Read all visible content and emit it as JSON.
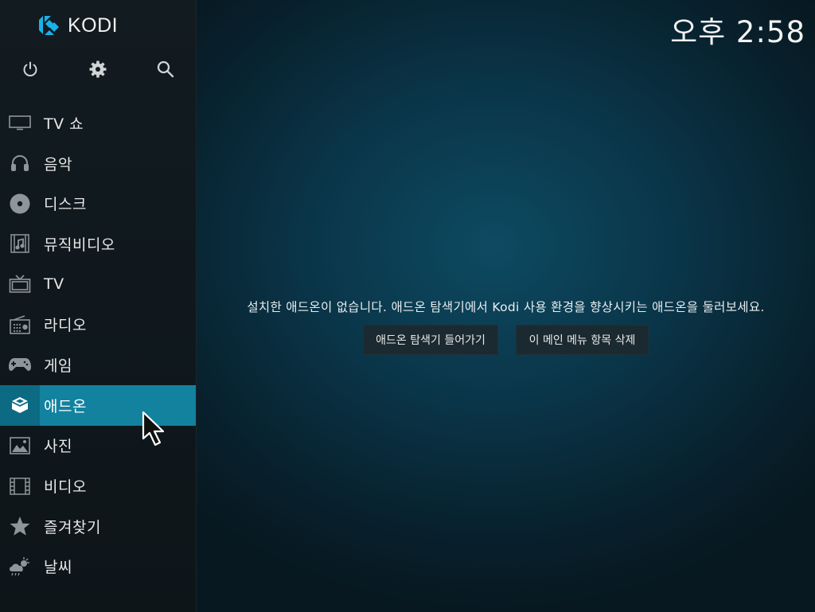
{
  "app": {
    "logo_text": "KODI"
  },
  "clock": "오후 2:58",
  "top_icons": [
    "power-icon",
    "settings-icon",
    "search-icon"
  ],
  "menu": [
    {
      "label": "TV 쇼",
      "icon": "tv-icon",
      "active": false
    },
    {
      "label": "음악",
      "icon": "headphones-icon",
      "active": false
    },
    {
      "label": "디스크",
      "icon": "disc-icon",
      "active": false
    },
    {
      "label": "뮤직비디오",
      "icon": "music-video-icon",
      "active": false
    },
    {
      "label": "TV",
      "icon": "live-tv-icon",
      "active": false
    },
    {
      "label": "라디오",
      "icon": "radio-icon",
      "active": false
    },
    {
      "label": "게임",
      "icon": "gamepad-icon",
      "active": false
    },
    {
      "label": "애드온",
      "icon": "addon-box-icon",
      "active": true
    },
    {
      "label": "사진",
      "icon": "picture-icon",
      "active": false
    },
    {
      "label": "비디오",
      "icon": "film-icon",
      "active": false
    },
    {
      "label": "즐겨찾기",
      "icon": "star-icon",
      "active": false
    },
    {
      "label": "날씨",
      "icon": "weather-icon",
      "active": false
    }
  ],
  "main": {
    "message": "설치한 애드온이 없습니다. 애드온 탐색기에서 Kodi 사용 환경을 향상시키는 애드온을 둘러보세요.",
    "buttons": {
      "browser": "애드온 탐색기 들어가기",
      "remove": "이 메인 메뉴 항목 삭제"
    }
  },
  "colors": {
    "accent": "#12829f",
    "sidebar": "#121b20",
    "background": "#0a3447"
  }
}
